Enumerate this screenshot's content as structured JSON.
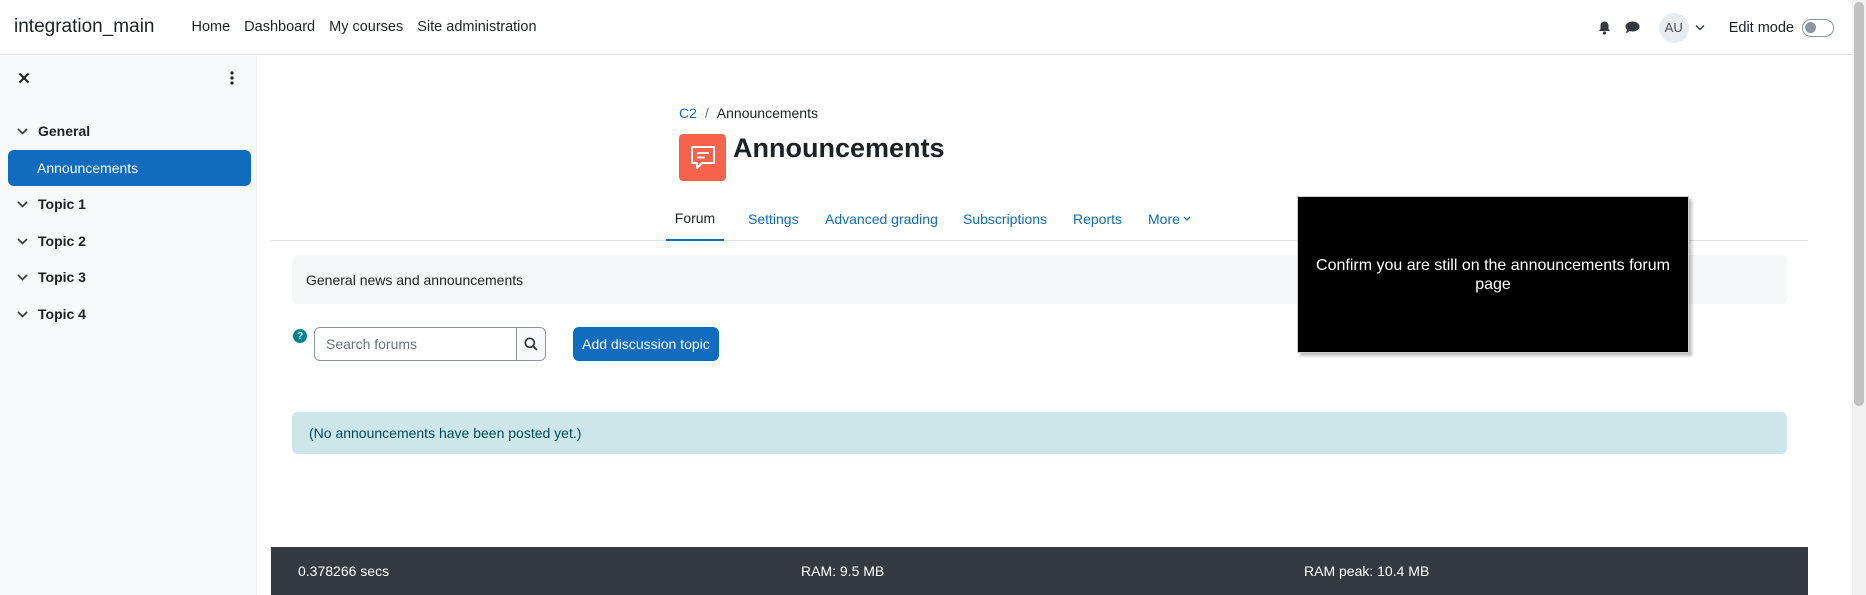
{
  "navbar": {
    "brand": "integration_main",
    "links": [
      "Home",
      "Dashboard",
      "My courses",
      "Site administration"
    ],
    "avatar_initials": "AU",
    "edit_mode_label": "Edit mode",
    "icons": {
      "notifications": "bell-icon",
      "messages": "chat-bubble-icon"
    }
  },
  "drawer": {
    "sections": [
      "General",
      "Topic 1",
      "Topic 2",
      "Topic 3",
      "Topic 4"
    ],
    "active_activity": "Announcements"
  },
  "breadcrumb": {
    "course": "C2",
    "current": "Announcements"
  },
  "page": {
    "title": "Announcements",
    "tabs": [
      "Forum",
      "Settings",
      "Advanced grading",
      "Subscriptions",
      "Reports",
      "More"
    ],
    "active_tab": "Forum",
    "intro": "General news and announcements",
    "search_placeholder": "Search forums",
    "add_button": "Add discussion topic",
    "empty_notice": "(No announcements have been posted yet.)"
  },
  "footer": {
    "time": "0.378266 secs",
    "ram": "RAM: 9.5 MB",
    "ram_peak": "RAM peak: 10.4 MB"
  },
  "overlay": {
    "message": "Confirm you are still on the announcements forum page"
  },
  "colors": {
    "primary": "#0f6cbf",
    "forum_icon_bg": "#f7634d",
    "alert_bg": "#cce6ea",
    "footer_bg": "#343a40",
    "overlay_bg": "#000000"
  }
}
